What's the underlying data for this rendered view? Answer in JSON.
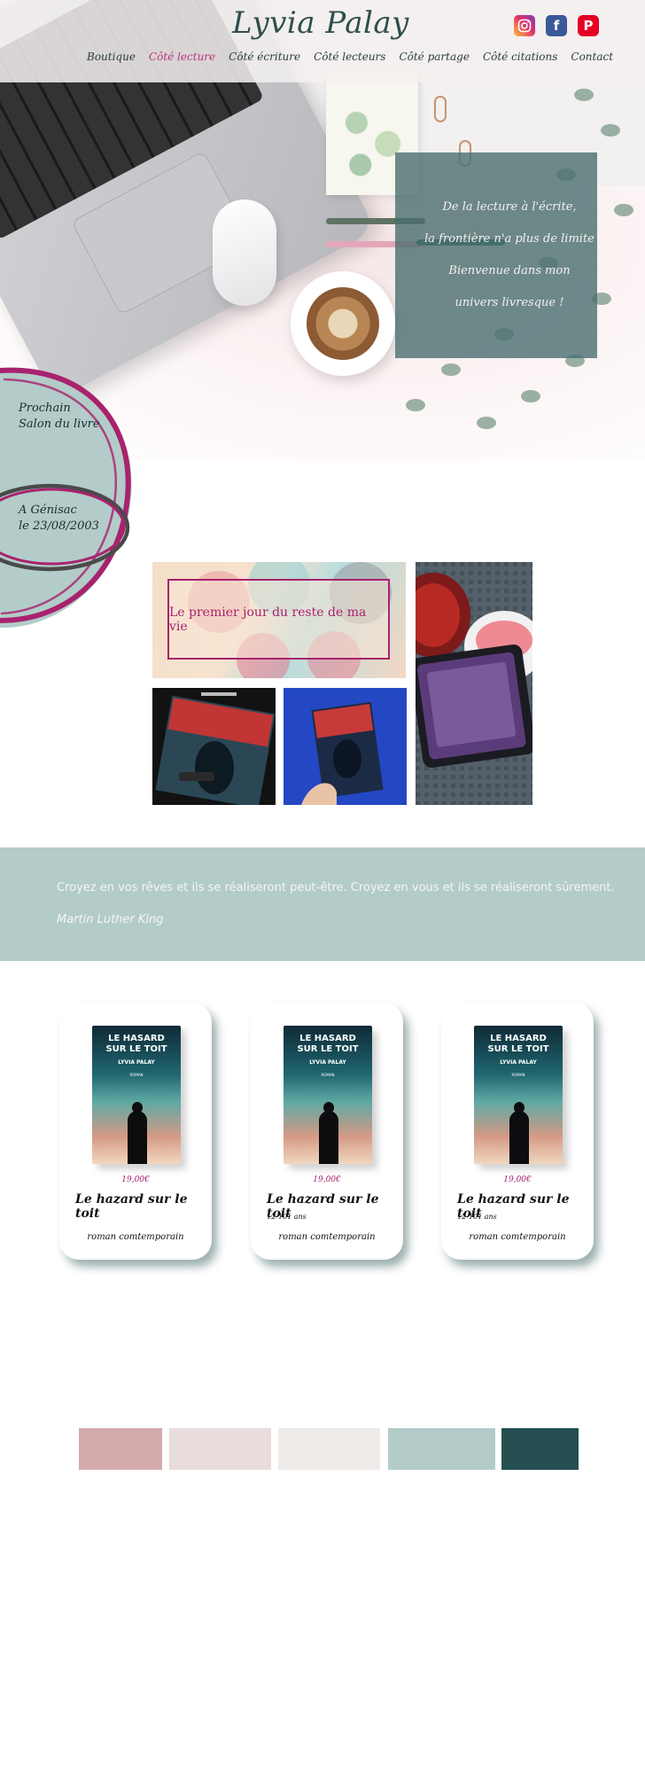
{
  "header": {
    "logo": "Lyvia Palay",
    "nav": [
      "Boutique",
      "Côté lecture",
      "Côté écriture",
      "Côté lecteurs",
      "Côté partage",
      "Côté citations",
      "Contact"
    ],
    "active_nav": "Côté lecture",
    "social": [
      {
        "name": "instagram-icon",
        "color": "#e1306c"
      },
      {
        "name": "facebook-icon",
        "color": "#3b5998"
      },
      {
        "name": "pinterest-icon",
        "color": "#e60023"
      }
    ]
  },
  "hero": {
    "quote_lines": [
      "De la lecture à l'écrite,",
      "la frontière n'a plus de limite",
      "Bienvenue dans mon",
      "univers livresque !"
    ]
  },
  "salon": {
    "title": "Prochain\nSalon du livre",
    "place_date": "A Génisac\nle 23/08/2003"
  },
  "gallery": {
    "featured_title": "Le premier jour du reste de ma vie"
  },
  "citation": {
    "text": "Croyez en vos rêves et ils se réaliseront peut-être. Croyez en vous et ils se réaliseront sûrement.",
    "author": "Martin Luther King"
  },
  "books": [
    {
      "cover_title": "LE HASARD\nSUR LE TOIT",
      "cover_author": "LYVIA PALAY",
      "cover_label": "ROMAN",
      "price": "19,00€",
      "title": "Le hazard sur le toit",
      "age": "",
      "genre": "roman comtemporain"
    },
    {
      "cover_title": "LE HASARD\nSUR LE TOIT",
      "cover_author": "LYVIA PALAY",
      "cover_label": "ROMAN",
      "price": "19,00€",
      "title": "Le hazard sur le toit",
      "age": "12-101 ans",
      "genre": "roman comtemporain"
    },
    {
      "cover_title": "LE HASARD\nSUR LE TOIT",
      "cover_author": "LYVIA PALAY",
      "cover_label": "ROMAN",
      "price": "19,00€",
      "title": "Le hazard sur le toit",
      "age": "12-101 ans",
      "genre": "roman comtemporain"
    }
  ],
  "palette": [
    "#d4abad",
    "#e8dcdd",
    "#efebe9",
    "#b3ccc9",
    "#264f52"
  ],
  "colors": {
    "accent": "#a8226e",
    "dark": "#264f52",
    "sage": "#b3ccc9"
  }
}
